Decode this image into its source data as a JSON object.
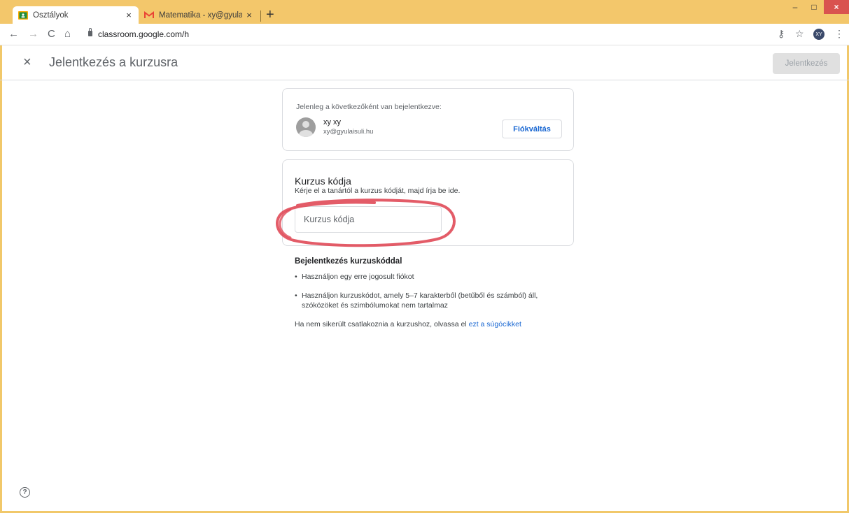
{
  "browser": {
    "tabs": [
      {
        "title": "Osztályok",
        "active": true,
        "favicon": "classroom-icon"
      },
      {
        "title": "Matematika - xy@gyulaisuli.hu -",
        "active": false,
        "favicon": "gmail-icon"
      }
    ],
    "tab_close": "×",
    "new_tab": "+",
    "url": "classroom.google.com/h",
    "profile_initials": "XY",
    "window_controls": {
      "minimize": "–",
      "maximize": "□",
      "close": "×"
    },
    "nav": {
      "back": "←",
      "forward": "→",
      "reload": "C",
      "home": "⌂"
    },
    "toolbar_icons": {
      "key": "⚷",
      "star": "☆",
      "menu": "⋮"
    }
  },
  "header": {
    "close": "×",
    "title": "Jelentkezés a kurzusra",
    "join_button": "Jelentkezés"
  },
  "account_card": {
    "caption": "Jelenleg a következőként van bejelentkezve:",
    "name": "xy xy",
    "email": "xy@gyulaisuli.hu",
    "switch_button": "Fiókváltás"
  },
  "code_card": {
    "title": "Kurzus kódja",
    "subtitle": "Kérje el a tanártól a kurzus kódját, majd írja be ide.",
    "input_placeholder": "Kurzus kódja"
  },
  "help": {
    "title": "Bejelentkezés kurzuskóddal",
    "bullet": "•",
    "bullets": [
      "Használjon egy erre jogosult fiókot",
      "Használjon kurzuskódot, amely 5–7 karakterből (betűből és számból) áll,",
      "szóközöket és szimbólumokat nem tartalmaz"
    ],
    "footer_text": "Ha nem sikerült csatlakoznia a kurzushoz, olvassa el",
    "footer_link": "ezt a súgócikket"
  },
  "help_icon": "?",
  "colors": {
    "tabstrip": "#f3c76b",
    "link": "#1967d2",
    "annotation": "#e04a58",
    "disabled_button": "#e0e0e0"
  }
}
